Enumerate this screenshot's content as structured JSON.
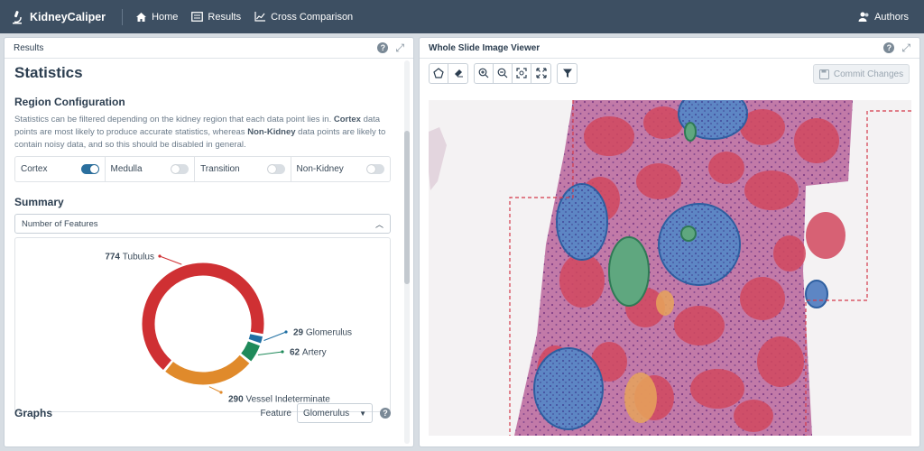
{
  "app": {
    "name": "KidneyCaliper"
  },
  "nav": [
    {
      "label": "Home",
      "icon": "home-icon"
    },
    {
      "label": "Results",
      "icon": "results-icon"
    },
    {
      "label": "Cross Comparison",
      "icon": "chart-icon"
    }
  ],
  "nav_right": {
    "label": "Authors",
    "icon": "users-icon"
  },
  "left_panel": {
    "header": "Results",
    "title": "Statistics",
    "region_title": "Region Configuration",
    "desc_part1": "Statistics can be filtered depending on the kidney region that each data point lies in.",
    "desc_bold1": "Cortex",
    "desc_part2": "data points are most likely to produce accurate statistics, whereas",
    "desc_bold2": "Non-Kidney",
    "desc_part3": "data points are likely to contain noisy data, and so this should be disabled in general.",
    "regions": [
      {
        "label": "Cortex",
        "enabled": true
      },
      {
        "label": "Medulla",
        "enabled": false
      },
      {
        "label": "Transition",
        "enabled": false
      },
      {
        "label": "Non-Kidney",
        "enabled": false
      }
    ],
    "summary_title": "Summary",
    "summary_select": "Number of Features",
    "graphs_title": "Graphs",
    "feature_label": "Feature",
    "feature_value": "Glomerulus"
  },
  "right_panel": {
    "header": "Whole Slide Image Viewer",
    "commit_label": "Commit Changes"
  },
  "chart_data": {
    "type": "pie",
    "categories": [
      "Tubulus",
      "Glomerulus",
      "Artery",
      "Vessel Indeterminate"
    ],
    "values": [
      774,
      29,
      62,
      290
    ],
    "colors": [
      "#cf3033",
      "#1f6fa3",
      "#1f8a5a",
      "#e08a2b"
    ],
    "labels": [
      "774 Tubulus",
      "29 Glomerulus",
      "62 Artery",
      "290 Vessel Indeterminate"
    ],
    "donut": true
  }
}
